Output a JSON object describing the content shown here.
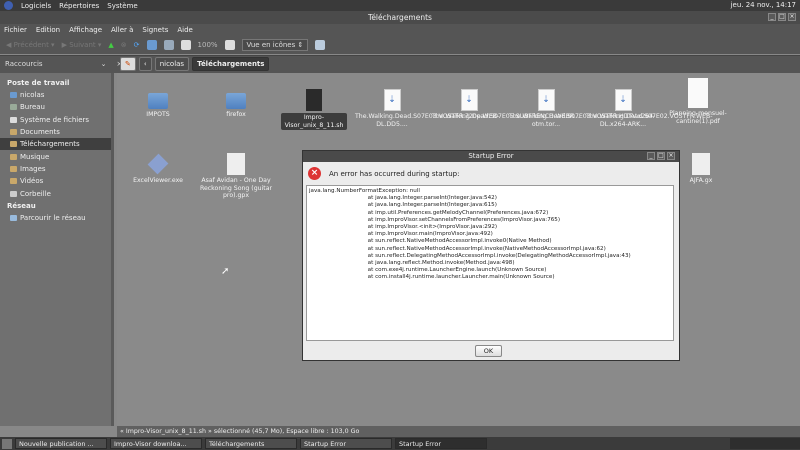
{
  "top_panel": {
    "menus": [
      "Logiciels",
      "Répertoires",
      "Système"
    ],
    "clock": "jeu. 24 nov., 14:17"
  },
  "window": {
    "title": "Téléchargements"
  },
  "menubar": [
    "Fichier",
    "Edition",
    "Affichage",
    "Aller à",
    "Signets",
    "Aide"
  ],
  "toolbar": {
    "back": "Précédent",
    "forward": "Suivant",
    "zoom": "100%",
    "view": "Vue en icônes"
  },
  "sidebar": {
    "header": "Raccourcis",
    "section1": "Poste de travail",
    "items": [
      "nicolas",
      "Bureau",
      "Système de fichiers",
      "Documents",
      "Téléchargements",
      "Musique",
      "Images",
      "Vidéos",
      "Corbeille"
    ],
    "section2": "Réseau",
    "network_items": [
      "Parcourir le réseau"
    ]
  },
  "breadcrumb": [
    "nicolas",
    "Téléchargements"
  ],
  "files": [
    {
      "name": "IMPOTS",
      "type": "folder"
    },
    {
      "name": "firefox",
      "type": "folder"
    },
    {
      "name": "Impro-Visor_unix_8_11.sh",
      "type": "script",
      "selected": true
    },
    {
      "name": "The.Walking.Dead.S07E03.VOSTFR.720p.WEB-DL.DD5....",
      "type": "torrent"
    },
    {
      "name": "The.Walking.Dead.S07E05.SUBFRENCH.WEBR...",
      "type": "torrent"
    },
    {
      "name": "The.Walking.Dead.S07E03.VOSTFR.HDTV.x264-otm.tor...",
      "type": "torrent"
    },
    {
      "name": "The.Walking.Dead.S07E02.VOSTFR.WEB-DL.x264-ARK...",
      "type": "torrent"
    },
    {
      "name": "Planning-mensuel-cantine(1).pdf",
      "type": "pdf"
    },
    {
      "name": "ExcelViewer.exe",
      "type": "exe"
    },
    {
      "name": "Asaf Avidan - One Day Reckoning Song (guitar pro).gpx",
      "type": "doc"
    },
    {
      "name": "AJFA.gx",
      "type": "doc"
    }
  ],
  "status": "« Impro-Visor_unix_8_11.sh » sélectionné (45,7 Mo), Espace libre : 103,0 Go",
  "taskbar": [
    "Nouvelle publication ...",
    "Impro-Visor downloa...",
    "Téléchargements",
    "Startup Error",
    "Startup Error"
  ],
  "dialog": {
    "title": "Startup Error",
    "message": "An error has occurred during startup:",
    "trace": [
      "java.lang.NumberFormatException: null",
      "\tat java.lang.Integer.parseInt(Integer.java:542)",
      "\tat java.lang.Integer.parseInt(Integer.java:615)",
      "\tat imp.util.Preferences.getMelodyChannel(Preferences.java:672)",
      "\tat imp.ImproVisor.setChannelsFromPreferences(ImproVisor.java:765)",
      "\tat imp.ImproVisor.<init>(ImproVisor.java:292)",
      "\tat imp.ImproVisor.main(ImproVisor.java:492)",
      "\tat sun.reflect.NativeMethodAccessorImpl.invoke0(Native Method)",
      "\tat sun.reflect.NativeMethodAccessorImpl.invoke(NativeMethodAccessorImpl.java:62)",
      "\tat sun.reflect.DelegatingMethodAccessorImpl.invoke(DelegatingMethodAccessorImpl.java:43)",
      "\tat java.lang.reflect.Method.invoke(Method.java:498)",
      "\tat com.exe4j.runtime.LauncherEngine.launch(Unknown Source)",
      "\tat com.install4j.runtime.launcher.Launcher.main(Unknown Source)"
    ],
    "ok": "OK"
  }
}
